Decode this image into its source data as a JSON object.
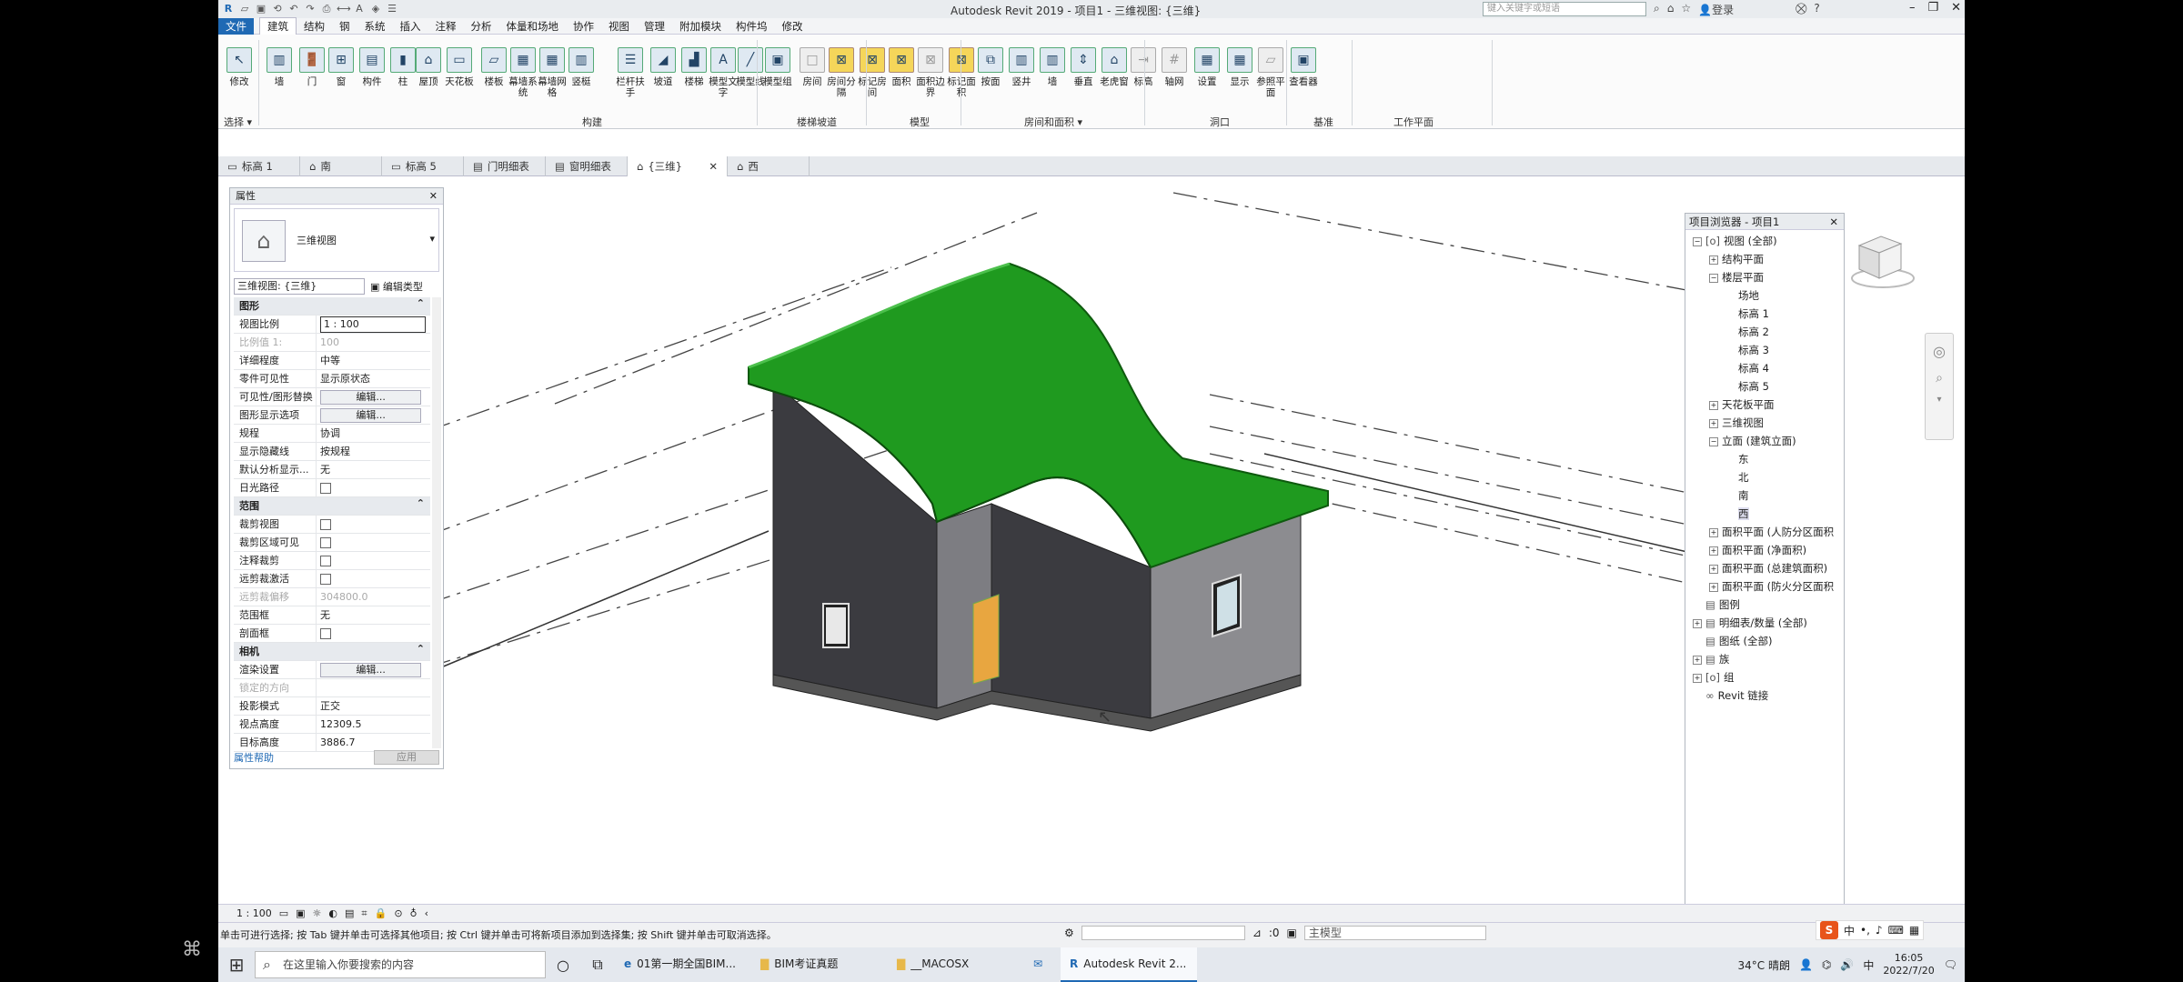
{
  "titlebar": {
    "app_title": "Autodesk Revit 2019 - 项目1 - 三维视图: {三维}",
    "search_placeholder": "键入关键字或短语",
    "signin": "登录",
    "help": "?"
  },
  "menubar": {
    "tabs": [
      "文件",
      "建筑",
      "结构",
      "钢",
      "系统",
      "插入",
      "注释",
      "分析",
      "体量和场地",
      "协作",
      "视图",
      "管理",
      "附加模块",
      "构件坞",
      "修改"
    ]
  },
  "ribbon": {
    "buttons": [
      {
        "label": "修改",
        "icon": "↖"
      },
      {
        "label": "墙",
        "icon": "▥"
      },
      {
        "label": "门",
        "icon": "🚪"
      },
      {
        "label": "窗",
        "icon": "⊞"
      },
      {
        "label": "构件",
        "icon": "▤"
      },
      {
        "label": "柱",
        "icon": "▮"
      },
      {
        "label": "屋顶",
        "icon": "⌂"
      },
      {
        "label": "天花板",
        "icon": "▭"
      },
      {
        "label": "楼板",
        "icon": "▱"
      },
      {
        "label": "幕墙系统",
        "icon": "▦"
      },
      {
        "label": "幕墙网格",
        "icon": "▦"
      },
      {
        "label": "竖梃",
        "icon": "▥"
      },
      {
        "label": "栏杆扶手",
        "icon": "☰"
      },
      {
        "label": "坡道",
        "icon": "◢"
      },
      {
        "label": "楼梯",
        "icon": "▟"
      },
      {
        "label": "模型文字",
        "icon": "A"
      },
      {
        "label": "模型线",
        "icon": "╱"
      },
      {
        "label": "模型组",
        "icon": "▣"
      },
      {
        "label": "房间",
        "icon": "□"
      },
      {
        "label": "房间分隔",
        "icon": "⊠"
      },
      {
        "label": "标记房间",
        "icon": "⊠"
      },
      {
        "label": "面积",
        "icon": "⊠"
      },
      {
        "label": "面积边界",
        "icon": "⊠"
      },
      {
        "label": "标记面积",
        "icon": "⊠"
      },
      {
        "label": "按面",
        "icon": "⧉"
      },
      {
        "label": "竖井",
        "icon": "▥"
      },
      {
        "label": "墙",
        "icon": "▥"
      },
      {
        "label": "垂直",
        "icon": "⇕"
      },
      {
        "label": "老虎窗",
        "icon": "⌂"
      },
      {
        "label": "标高",
        "icon": "⇥"
      },
      {
        "label": "轴网",
        "icon": "#"
      },
      {
        "label": "设置",
        "icon": "▦"
      },
      {
        "label": "显示",
        "icon": "▦"
      },
      {
        "label": "参照平面",
        "icon": "▱"
      },
      {
        "label": "查看器",
        "icon": "▣"
      }
    ],
    "groups": {
      "select": "选择 ▾",
      "build": "构建",
      "circulation": "楼梯坡道",
      "model": "模型",
      "room_area": "房间和面积 ▾",
      "opening": "洞口",
      "datum": "基准",
      "workplane": "工作平面"
    }
  },
  "view_tabs": [
    {
      "label": "标高 1",
      "icon": "▭"
    },
    {
      "label": "南",
      "icon": "⌂"
    },
    {
      "label": "标高 5",
      "icon": "▭"
    },
    {
      "label": "门明细表",
      "icon": "▤"
    },
    {
      "label": "窗明细表",
      "icon": "▤"
    },
    {
      "label": "{三维}",
      "icon": "⌂",
      "active": true
    },
    {
      "label": "西",
      "icon": "⌂"
    }
  ],
  "properties": {
    "title": "属性",
    "type_name": "三维视图",
    "selector": "三维视图: {三维}",
    "edit_type": "编辑类型",
    "rows": [
      {
        "k": "图形",
        "v": "",
        "sec": true
      },
      {
        "k": "视图比例",
        "v": "1 : 100",
        "kind": "input"
      },
      {
        "k": "比例值 1:",
        "v": "100",
        "dis": true
      },
      {
        "k": "详细程度",
        "v": "中等"
      },
      {
        "k": "零件可见性",
        "v": "显示原状态"
      },
      {
        "k": "可见性/图形替换",
        "v": "编辑...",
        "kind": "btn"
      },
      {
        "k": "图形显示选项",
        "v": "编辑...",
        "kind": "btn"
      },
      {
        "k": "规程",
        "v": "协调"
      },
      {
        "k": "显示隐藏线",
        "v": "按规程"
      },
      {
        "k": "默认分析显示...",
        "v": "无"
      },
      {
        "k": "日光路径",
        "v": "",
        "kind": "cb"
      },
      {
        "k": "范围",
        "v": "",
        "sec": true
      },
      {
        "k": "裁剪视图",
        "v": "",
        "kind": "cb"
      },
      {
        "k": "裁剪区域可见",
        "v": "",
        "kind": "cb"
      },
      {
        "k": "注释裁剪",
        "v": "",
        "kind": "cb"
      },
      {
        "k": "远剪裁激活",
        "v": "",
        "kind": "cb"
      },
      {
        "k": "远剪裁偏移",
        "v": "304800.0",
        "dis": true
      },
      {
        "k": "范围框",
        "v": "无"
      },
      {
        "k": "剖面框",
        "v": "",
        "kind": "cb"
      },
      {
        "k": "相机",
        "v": "",
        "sec": true
      },
      {
        "k": "渲染设置",
        "v": "编辑...",
        "kind": "btn"
      },
      {
        "k": "锁定的方向",
        "v": "",
        "dis": true
      },
      {
        "k": "投影模式",
        "v": "正交"
      },
      {
        "k": "视点高度",
        "v": "12309.5"
      },
      {
        "k": "目标高度",
        "v": "3886.7"
      }
    ],
    "help_link": "属性帮助",
    "apply": "应用"
  },
  "browser": {
    "title": "项目浏览器 - 项目1",
    "nodes": [
      {
        "label": "视图 (全部)",
        "depth": 0,
        "tg": "⊟",
        "icon": "[o]"
      },
      {
        "label": "结构平面",
        "depth": 1,
        "tg": "⊞"
      },
      {
        "label": "楼层平面",
        "depth": 1,
        "tg": "⊟"
      },
      {
        "label": "场地",
        "depth": 2
      },
      {
        "label": "标高 1",
        "depth": 2
      },
      {
        "label": "标高 2",
        "depth": 2
      },
      {
        "label": "标高 3",
        "depth": 2
      },
      {
        "label": "标高 4",
        "depth": 2
      },
      {
        "label": "标高 5",
        "depth": 2
      },
      {
        "label": "天花板平面",
        "depth": 1,
        "tg": "⊞"
      },
      {
        "label": "三维视图",
        "depth": 1,
        "tg": "⊞"
      },
      {
        "label": "立面 (建筑立面)",
        "depth": 1,
        "tg": "⊟"
      },
      {
        "label": "东",
        "depth": 2
      },
      {
        "label": "北",
        "depth": 2
      },
      {
        "label": "南",
        "depth": 2
      },
      {
        "label": "西",
        "depth": 2,
        "sel": true
      },
      {
        "label": "面积平面 (人防分区面积",
        "depth": 1,
        "tg": "⊞"
      },
      {
        "label": "面积平面 (净面积)",
        "depth": 1,
        "tg": "⊞"
      },
      {
        "label": "面积平面 (总建筑面积)",
        "depth": 1,
        "tg": "⊞"
      },
      {
        "label": "面积平面 (防火分区面积",
        "depth": 1,
        "tg": "⊞"
      },
      {
        "label": "图例",
        "depth": 0,
        "icon": "▤"
      },
      {
        "label": "明细表/数量 (全部)",
        "depth": 0,
        "tg": "⊞",
        "icon": "▤"
      },
      {
        "label": "图纸 (全部)",
        "depth": 0,
        "icon": "▤"
      },
      {
        "label": "族",
        "depth": 0,
        "tg": "⊞",
        "icon": "▤"
      },
      {
        "label": "组",
        "depth": 0,
        "tg": "⊞",
        "icon": "[o]"
      },
      {
        "label": "Revit 链接",
        "depth": 0,
        "icon": "∞"
      }
    ]
  },
  "status": {
    "scale": "1 : 100",
    "message": "单击可进行选择; 按 Tab 键并单击可选择其他项目; 按 Ctrl 键并单击可将新项目添加到选择集; 按 Shift 键并单击可取消选择。",
    "zero": ":0",
    "model_label": "主模型"
  },
  "taskbar": {
    "search_placeholder": "在这里输入你要搜索的内容",
    "apps": [
      {
        "label": "01第一期全国BIM...",
        "icon": "e"
      },
      {
        "label": "BIM考证真题",
        "icon": "▇"
      },
      {
        "label": "__MACOSX",
        "icon": "▇"
      },
      {
        "label": "",
        "icon": "✉"
      },
      {
        "label": "Autodesk Revit 2...",
        "icon": "R",
        "active": true
      }
    ],
    "weather": "34°C 晴朗",
    "time": "16:05",
    "date": "2022/7/20",
    "ime": "中"
  },
  "colors": {
    "roof": "#1f9a1f",
    "wall_dark": "#3f3f45",
    "wall_light": "#8a8a8a",
    "door": "#e8a640",
    "accent": "#1f69b4"
  }
}
